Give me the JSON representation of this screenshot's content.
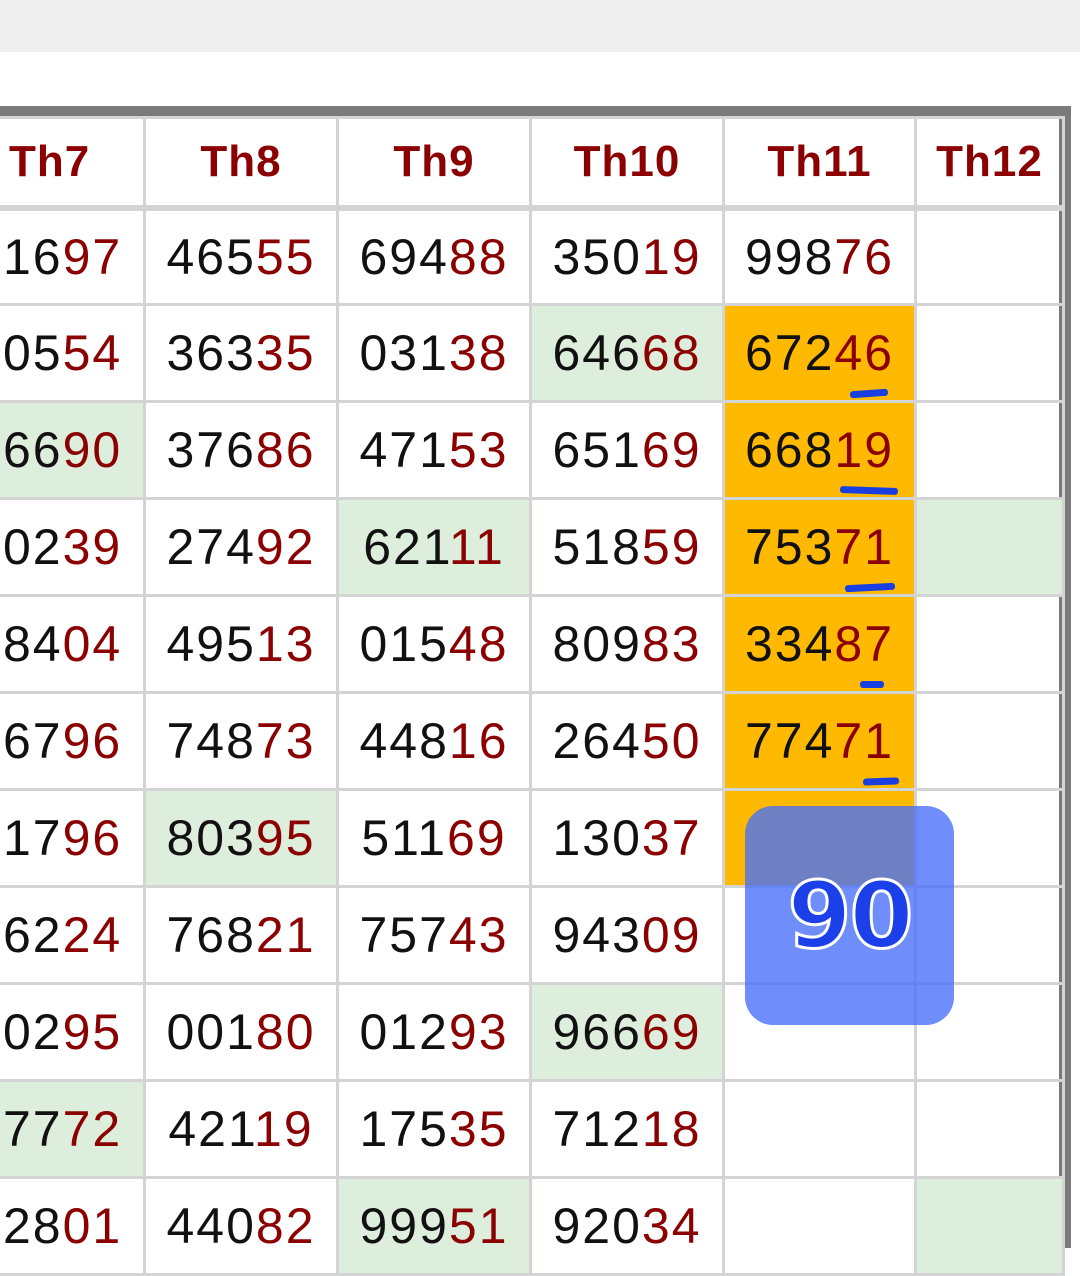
{
  "headers": [
    "Th7",
    "Th8",
    "Th9",
    "Th10",
    "Th11",
    "Th12"
  ],
  "rows": [
    [
      {
        "h1": "16",
        "h2": "97"
      },
      {
        "h1": "465",
        "h2": "55"
      },
      {
        "h1": "694",
        "h2": "88"
      },
      {
        "h1": "350",
        "h2": "19"
      },
      {
        "h1": "998",
        "h2": "76"
      },
      {
        "h1": "",
        "h2": ""
      }
    ],
    [
      {
        "h1": "05",
        "h2": "54"
      },
      {
        "h1": "363",
        "h2": "35"
      },
      {
        "h1": "031",
        "h2": "38"
      },
      {
        "h1": "646",
        "h2": "68",
        "hl": "green"
      },
      {
        "h1": "672",
        "h2": "46",
        "hl": "orange"
      },
      {
        "h1": "",
        "h2": ""
      }
    ],
    [
      {
        "h1": "66",
        "h2": "90",
        "hl": "green"
      },
      {
        "h1": "376",
        "h2": "86"
      },
      {
        "h1": "471",
        "h2": "53"
      },
      {
        "h1": "651",
        "h2": "69"
      },
      {
        "h1": "668",
        "h2": "19",
        "hl": "orange"
      },
      {
        "h1": "",
        "h2": ""
      }
    ],
    [
      {
        "h1": "02",
        "h2": "39"
      },
      {
        "h1": "274",
        "h2": "92"
      },
      {
        "h1": "621",
        "h2": "11",
        "hl": "green"
      },
      {
        "h1": "518",
        "h2": "59"
      },
      {
        "h1": "753",
        "h2": "71",
        "hl": "orange"
      },
      {
        "h1": "",
        "h2": "",
        "hl": "green"
      }
    ],
    [
      {
        "h1": "84",
        "h2": "04"
      },
      {
        "h1": "495",
        "h2": "13"
      },
      {
        "h1": "015",
        "h2": "48"
      },
      {
        "h1": "809",
        "h2": "83"
      },
      {
        "h1": "334",
        "h2": "87",
        "hl": "orange"
      },
      {
        "h1": "",
        "h2": ""
      }
    ],
    [
      {
        "h1": "67",
        "h2": "96"
      },
      {
        "h1": "748",
        "h2": "73"
      },
      {
        "h1": "448",
        "h2": "16"
      },
      {
        "h1": "264",
        "h2": "50"
      },
      {
        "h1": "774",
        "h2": "71",
        "hl": "orange"
      },
      {
        "h1": "",
        "h2": ""
      }
    ],
    [
      {
        "h1": "17",
        "h2": "96"
      },
      {
        "h1": "803",
        "h2": "95",
        "hl": "green"
      },
      {
        "h1": "511",
        "h2": "69"
      },
      {
        "h1": "130",
        "h2": "37"
      },
      {
        "h1": "",
        "h2": "",
        "hl": "orange"
      },
      {
        "h1": "",
        "h2": ""
      }
    ],
    [
      {
        "h1": "62",
        "h2": "24"
      },
      {
        "h1": "768",
        "h2": "21"
      },
      {
        "h1": "757",
        "h2": "43"
      },
      {
        "h1": "943",
        "h2": "09"
      },
      {
        "h1": "",
        "h2": ""
      },
      {
        "h1": "",
        "h2": ""
      }
    ],
    [
      {
        "h1": "02",
        "h2": "95"
      },
      {
        "h1": "001",
        "h2": "80"
      },
      {
        "h1": "012",
        "h2": "93"
      },
      {
        "h1": "966",
        "h2": "69",
        "hl": "green"
      },
      {
        "h1": "",
        "h2": ""
      },
      {
        "h1": "",
        "h2": ""
      }
    ],
    [
      {
        "h1": "77",
        "h2": "72",
        "hl": "green"
      },
      {
        "h1": "421",
        "h2": "19"
      },
      {
        "h1": "175",
        "h2": "35"
      },
      {
        "h1": "712",
        "h2": "18"
      },
      {
        "h1": "",
        "h2": ""
      },
      {
        "h1": "",
        "h2": ""
      }
    ],
    [
      {
        "h1": "28",
        "h2": "01"
      },
      {
        "h1": "440",
        "h2": "82"
      },
      {
        "h1": "999",
        "h2": "51",
        "hl": "green"
      },
      {
        "h1": "920",
        "h2": "34"
      },
      {
        "h1": "",
        "h2": ""
      },
      {
        "h1": "",
        "h2": "",
        "hl": "green"
      }
    ]
  ],
  "overlay": {
    "value": "90"
  },
  "colors": {
    "highlight_orange": "#ffb900",
    "highlight_green": "#ddeedd",
    "digit_red": "#8b0000",
    "overlay_blue": "#466efa",
    "underline_blue": "#1a3fe0"
  }
}
